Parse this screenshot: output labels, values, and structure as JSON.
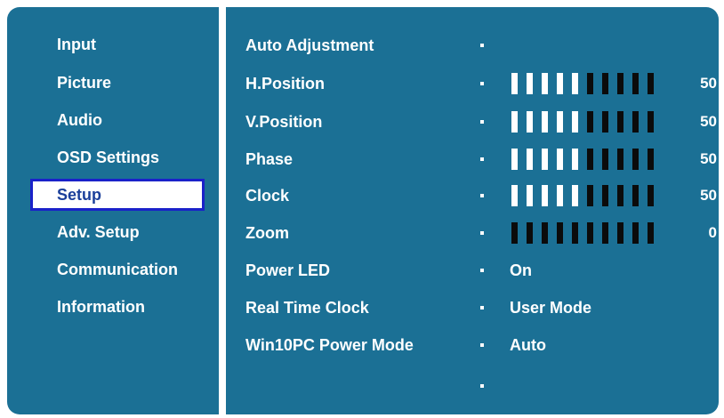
{
  "menu": {
    "items": [
      {
        "label": "Input",
        "selected": false
      },
      {
        "label": "Picture",
        "selected": false
      },
      {
        "label": "Audio",
        "selected": false
      },
      {
        "label": "OSD Settings",
        "selected": false
      },
      {
        "label": "Setup",
        "selected": true
      },
      {
        "label": "Adv. Setup",
        "selected": false
      },
      {
        "label": "Communication",
        "selected": false
      },
      {
        "label": "Information",
        "selected": false
      }
    ]
  },
  "settings": {
    "rows": [
      {
        "label": "Auto Adjustment",
        "type": "none"
      },
      {
        "label": "H.Position",
        "type": "bar",
        "value": "50",
        "fraction": 0.5
      },
      {
        "label": "V.Position",
        "type": "bar",
        "value": "50",
        "fraction": 0.5
      },
      {
        "label": "Phase",
        "type": "bar",
        "value": "50",
        "fraction": 0.5
      },
      {
        "label": "Clock",
        "type": "bar",
        "value": "50",
        "fraction": 0.5
      },
      {
        "label": "Zoom",
        "type": "bar",
        "value": "0",
        "fraction": 0.0
      },
      {
        "label": "Power LED",
        "type": "text",
        "value": "On"
      },
      {
        "label": "Real Time Clock",
        "type": "text",
        "value": "User Mode"
      },
      {
        "label": "Win10PC Power Mode",
        "type": "text",
        "value": "Auto"
      }
    ],
    "bar_segments": 10
  },
  "colors": {
    "panel": "#1b7095",
    "highlight_border": "#1a21c9",
    "highlight_text": "#1b3f9a"
  }
}
